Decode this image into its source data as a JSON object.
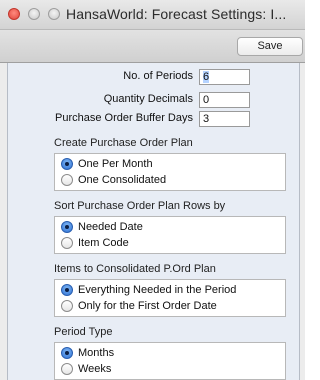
{
  "window": {
    "title": "HansaWorld: Forecast Settings: I...",
    "save_label": "Save"
  },
  "fields": [
    {
      "label": "No. of Periods",
      "value": "6"
    },
    {
      "label": "Quantity Decimals",
      "value": "0"
    },
    {
      "label": "Purchase Order Buffer Days",
      "value": "3"
    }
  ],
  "groups": [
    {
      "title": "Create Purchase Order Plan",
      "options": [
        "One Per Month",
        "One Consolidated"
      ],
      "selected": 0
    },
    {
      "title": "Sort Purchase Order Plan Rows by",
      "options": [
        "Needed Date",
        "Item Code"
      ],
      "selected": 0
    },
    {
      "title": "Items to Consolidated P.Ord Plan",
      "options": [
        "Everything Needed in the Period",
        "Only for the First Order Date"
      ],
      "selected": 0
    },
    {
      "title": "Period Type",
      "options": [
        "Months",
        "Weeks"
      ],
      "selected": 0
    }
  ]
}
